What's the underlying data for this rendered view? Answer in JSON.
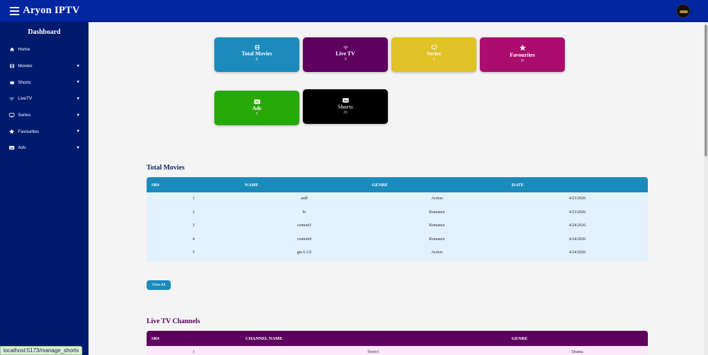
{
  "header": {
    "title": "Aryon IPTV"
  },
  "sidebar": {
    "heading": "Dashboard",
    "items": [
      {
        "label": "Home",
        "icon": "home-icon",
        "caret": ""
      },
      {
        "label": "Movies",
        "icon": "film-icon",
        "caret": "▼"
      },
      {
        "label": "Shorts",
        "icon": "clapper-icon",
        "caret": "▼"
      },
      {
        "label": "LiveTV",
        "icon": "broadcast-icon",
        "caret": "▼"
      },
      {
        "label": "Series",
        "icon": "tv-icon",
        "caret": "▼"
      },
      {
        "label": "Favourites",
        "icon": "star-icon",
        "caret": "▼"
      },
      {
        "label": "Ads",
        "icon": "ad-icon",
        "caret": "▼"
      }
    ]
  },
  "cards": [
    {
      "title": "Total Movies",
      "value": "6",
      "color": "#1b8bbd",
      "icon": "film-icon"
    },
    {
      "title": "Live TV",
      "value": "3",
      "color": "#5e005e",
      "icon": "broadcast-icon"
    },
    {
      "title": "Series",
      "value": "1",
      "color": "#e0c126",
      "icon": "tv-icon"
    },
    {
      "title": "Favourites",
      "value": "0",
      "color": "#aa0d6e",
      "icon": "star-icon"
    },
    {
      "title": "Ads",
      "value": "5",
      "color": "#26a806",
      "icon": "ad-icon"
    },
    {
      "title": "Shorts",
      "value": "20",
      "color": "#000000",
      "icon": "ad-icon"
    }
  ],
  "movies": {
    "title": "Total Movies",
    "header_color": "#1b8bbd",
    "row_color": "#e3f1fc",
    "columns": [
      "SR#",
      "NAME",
      "GENRE",
      "DATE"
    ],
    "rows": [
      [
        "1",
        "asdf",
        "Action",
        "4/23/2026"
      ],
      [
        "2",
        "hi",
        "Romance",
        "4/23/2026"
      ],
      [
        "3",
        "content3",
        "Romance",
        "4/24/2026"
      ],
      [
        "4",
        "content4",
        "Romance",
        "4/24/2026"
      ],
      [
        "5",
        "gta 6 2.0",
        "Action",
        "4/24/2026"
      ]
    ],
    "view_all": "View All"
  },
  "livetv": {
    "title": "Live TV Channels",
    "header_color": "#5e005e",
    "row_color": "#fbe9fb",
    "columns": [
      "SR#",
      "CHANNEL NAME",
      "GENRE"
    ],
    "rows": [
      [
        "1",
        "livetv1",
        "Drama"
      ]
    ]
  },
  "status_bar": {
    "url": "localhost:5173/manage_shorts"
  }
}
